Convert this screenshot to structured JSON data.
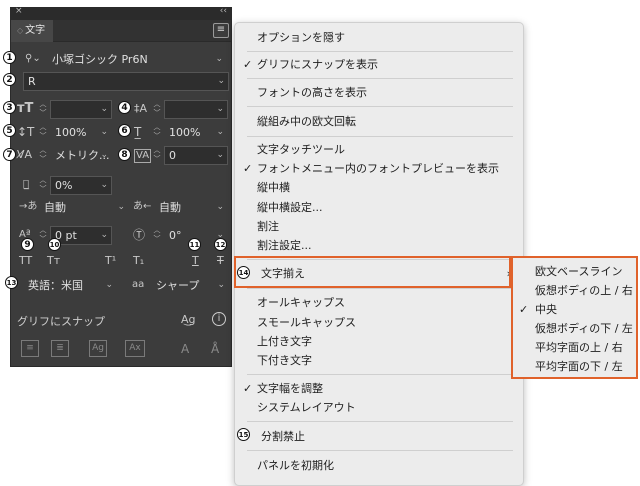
{
  "panel": {
    "tab_title": "文字",
    "font_family": "小塚ゴシック Pr6N",
    "font_style": "R",
    "font_size": "",
    "leading": "",
    "vertical_scale": "100%",
    "horizontal_scale": "100%",
    "kerning": "メトリク...",
    "tracking": "0",
    "tsume": "0%",
    "aki_left": "自動",
    "aki_right": "自動",
    "baseline_shift": "0 pt",
    "rotation": "0°",
    "caps_all": "TT",
    "caps_small": "Tт",
    "superscript": "T¹",
    "subscript": "T₁",
    "underline": "T",
    "strikethrough": "T",
    "language": "英語：米国",
    "antialias_icon": "aa",
    "antialias": "シャープ",
    "snap_label": "グリフにスナップ",
    "info_icon": "i"
  },
  "badges": [
    "1",
    "2",
    "3",
    "4",
    "5",
    "6",
    "7",
    "8",
    "9",
    "10",
    "11",
    "12",
    "13",
    "14",
    "15"
  ],
  "menu": {
    "hide_options": "オプションを隠す",
    "snap_glyph": "グリフにスナップを表示",
    "font_height": "フォントの高さを表示",
    "rotate_roman": "縦組み中の欧文回転",
    "touch_tool": "文字タッチツール",
    "font_preview": "フォントメニュー内のフォントプレビューを表示",
    "tatechuyoko": "縦中横",
    "tatechuyoko_settings": "縦中横設定...",
    "warichu": "割注",
    "warichu_settings": "割注設定...",
    "char_align": "文字揃え",
    "all_caps": "オールキャップス",
    "small_caps": "スモールキャップス",
    "superscript": "上付き文字",
    "subscript": "下付き文字",
    "adjust_width": "文字幅を調整",
    "system_layout": "システムレイアウト",
    "no_break": "分割禁止",
    "reset_panel": "パネルを初期化"
  },
  "submenu": {
    "items": [
      "欧文ベースライン",
      "仮想ボディの上 / 右",
      "中央",
      "仮想ボディの下 / 左",
      "平均字面の上 / 右",
      "平均字面の下 / 左"
    ]
  },
  "colors": {
    "highlight": "#e0622b",
    "panel_bg": "#3c3c3c",
    "menu_bg": "#ececec"
  }
}
